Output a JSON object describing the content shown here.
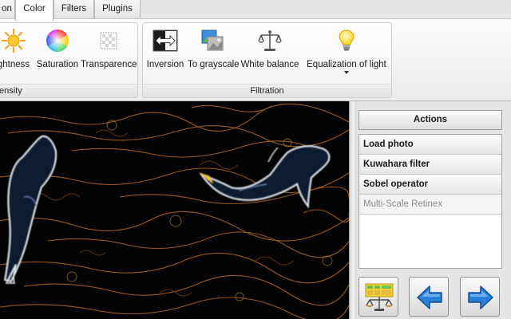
{
  "tabs": [
    {
      "label": "on"
    },
    {
      "label": "Color"
    },
    {
      "label": "Filters"
    },
    {
      "label": "Plugins"
    }
  ],
  "ribbon": {
    "groups": [
      {
        "label": "ensity",
        "buttons": [
          {
            "label": "ghtness",
            "icon": "sun-icon"
          },
          {
            "label": "Saturation",
            "icon": "color-wheel-icon"
          },
          {
            "label": "Transparence",
            "icon": "transparency-icon"
          }
        ]
      },
      {
        "label": "Filtration",
        "buttons": [
          {
            "label": "Inversion",
            "icon": "inversion-arrows-icon"
          },
          {
            "label": "To grayscale",
            "icon": "grayscale-image-icon"
          },
          {
            "label": "White balance",
            "icon": "balance-scale-icon"
          },
          {
            "label": "Equalization of light",
            "icon": "lightbulb-icon"
          }
        ]
      }
    ]
  },
  "actions": {
    "header": "Actions",
    "items": [
      {
        "label": "Load photo",
        "enabled": true
      },
      {
        "label": "Kuwahara filter",
        "enabled": true
      },
      {
        "label": "Sobel operator",
        "enabled": true
      },
      {
        "label": "Multi-Scale Retinex",
        "enabled": false
      }
    ]
  },
  "nav": {
    "icons": [
      "chart-scale-icon",
      "arrow-left-icon",
      "arrow-right-icon"
    ]
  },
  "colors": {
    "accent_blue": "#2a7fd6",
    "canvas_bg": "#030303",
    "edge_orange": "#c8782c",
    "edge_white": "#e8eef7"
  }
}
